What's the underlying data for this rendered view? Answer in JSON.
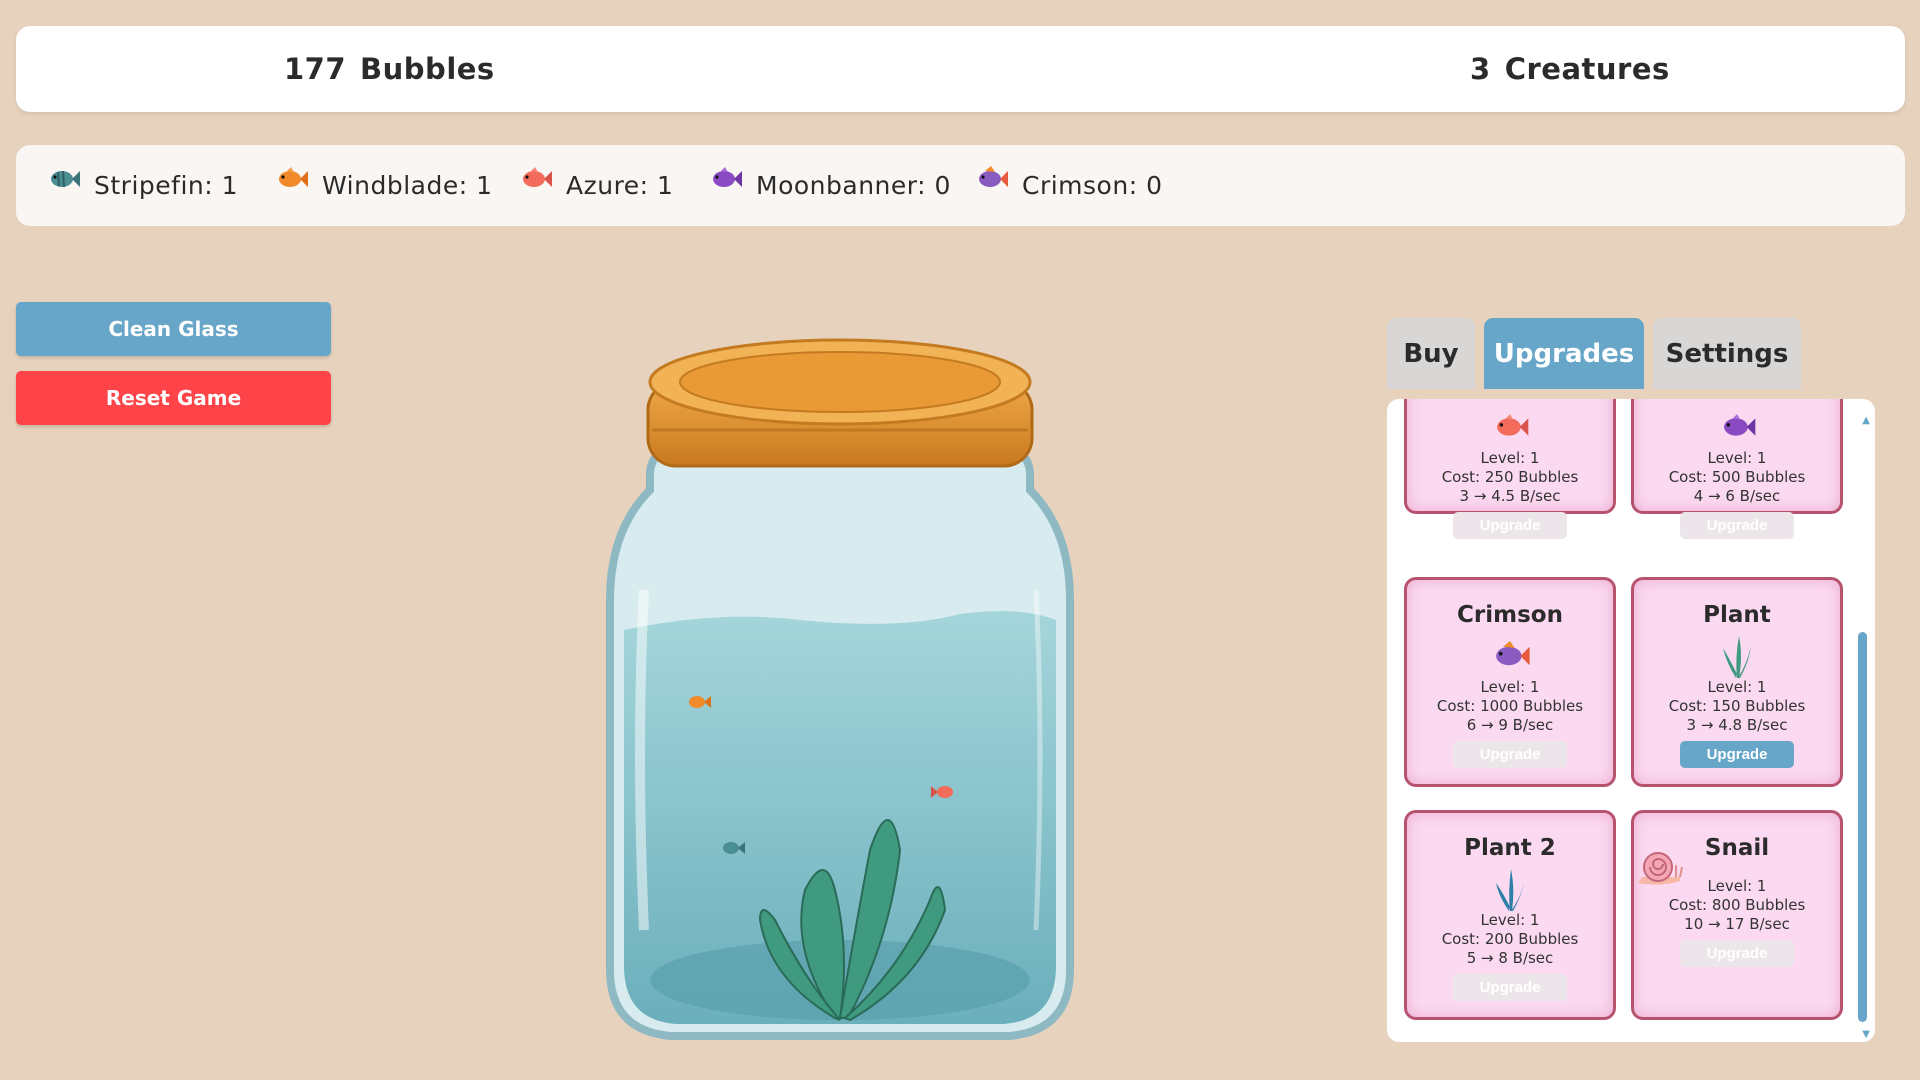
{
  "stats": {
    "bubbles_count": "177",
    "bubbles_label": "Bubbles",
    "creatures_count": "3",
    "creatures_label": "Creatures"
  },
  "creatures": [
    {
      "name": "Stripefin: 1",
      "icon": "stripefin-fish-icon",
      "color": "#4a8e92"
    },
    {
      "name": "Windblade: 1",
      "icon": "windblade-fish-icon",
      "color": "#f08a2b"
    },
    {
      "name": "Azure: 1",
      "icon": "azure-fish-icon",
      "color": "#f26b5b"
    },
    {
      "name": "Moonbanner: 0",
      "icon": "moonbanner-fish-icon",
      "color": "#8a4bc2"
    },
    {
      "name": "Crimson: 0",
      "icon": "crimson-fish-icon",
      "color": "#e85a3c"
    }
  ],
  "actions": {
    "clean_glass": "Clean Glass",
    "reset_game": "Reset Game"
  },
  "tabs": {
    "buy": "Buy",
    "upgrades": "Upgrades",
    "settings": "Settings",
    "active": "upgrades"
  },
  "upgrades": [
    {
      "name": "",
      "icon": "azure-fish-icon",
      "level": "Level: 1",
      "cost": "Cost: 250 Bubbles",
      "rate": "3 → 4.5 B/sec",
      "button": "Upgrade",
      "enabled": false
    },
    {
      "name": "",
      "icon": "moonbanner-fish-icon",
      "level": "Level: 1",
      "cost": "Cost: 500 Bubbles",
      "rate": "4 → 6 B/sec",
      "button": "Upgrade",
      "enabled": false
    },
    {
      "name": "Crimson",
      "icon": "crimson-fish-icon",
      "level": "Level: 1",
      "cost": "Cost: 1000 Bubbles",
      "rate": "6 → 9 B/sec",
      "button": "Upgrade",
      "enabled": false
    },
    {
      "name": "Plant",
      "icon": "plant-icon",
      "level": "Level: 1",
      "cost": "Cost: 150 Bubbles",
      "rate": "3 → 4.8 B/sec",
      "button": "Upgrade",
      "enabled": true
    },
    {
      "name": "Plant 2",
      "icon": "plant-2-icon",
      "level": "Level: 1",
      "cost": "Cost: 200 Bubbles",
      "rate": "5 → 8 B/sec",
      "button": "Upgrade",
      "enabled": false
    },
    {
      "name": "Snail",
      "icon": "snail-icon",
      "level": "Level: 1",
      "cost": "Cost: 800 Bubbles",
      "rate": "10 → 17 B/sec",
      "button": "Upgrade",
      "enabled": false
    }
  ],
  "colors": {
    "background": "#e6d2bd",
    "accent": "#67a6c8",
    "danger": "#ff4449",
    "card_bg": "#fbd9f0",
    "card_border": "#b7536f"
  }
}
